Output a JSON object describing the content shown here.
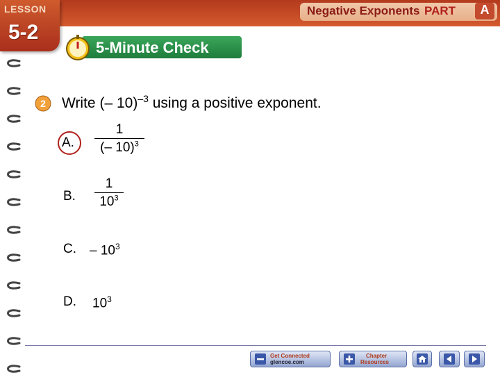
{
  "header": {
    "lesson_label": "LESSON",
    "lesson_number": "5-2",
    "title": "Negative Exponents",
    "part_label": "PART",
    "part_letter": "A"
  },
  "check_bar": {
    "label": "5-Minute Check"
  },
  "question": {
    "number": "2",
    "text_prefix": "Write (– 10)",
    "exponent": "–3",
    "text_suffix": " using a positive exponent."
  },
  "options": [
    {
      "label": "A.",
      "numerator": "1",
      "denominator_base": "(– 10)",
      "denominator_exp": "3",
      "selected": true
    },
    {
      "label": "B.",
      "numerator": "1",
      "denominator_base": "10",
      "denominator_exp": "3"
    },
    {
      "label": "C.",
      "value": "– 10",
      "value_exp": "3"
    },
    {
      "label": "D.",
      "value": "10",
      "value_exp": "3"
    }
  ],
  "nav": {
    "get_connected_line1": "Get Connected",
    "get_connected_line2": "glencoe.com",
    "chapter_resources_line1": "Chapter",
    "chapter_resources_line2": "Resources",
    "icons": [
      "minus-icon",
      "plus-icon",
      "home-icon",
      "back-arrow-icon",
      "forward-arrow-icon"
    ]
  },
  "colors": {
    "banner": "#b33a1d",
    "check_bar": "#2a8f47",
    "selected_ring": "#b0201a",
    "nav_button": "#93a4d0"
  }
}
